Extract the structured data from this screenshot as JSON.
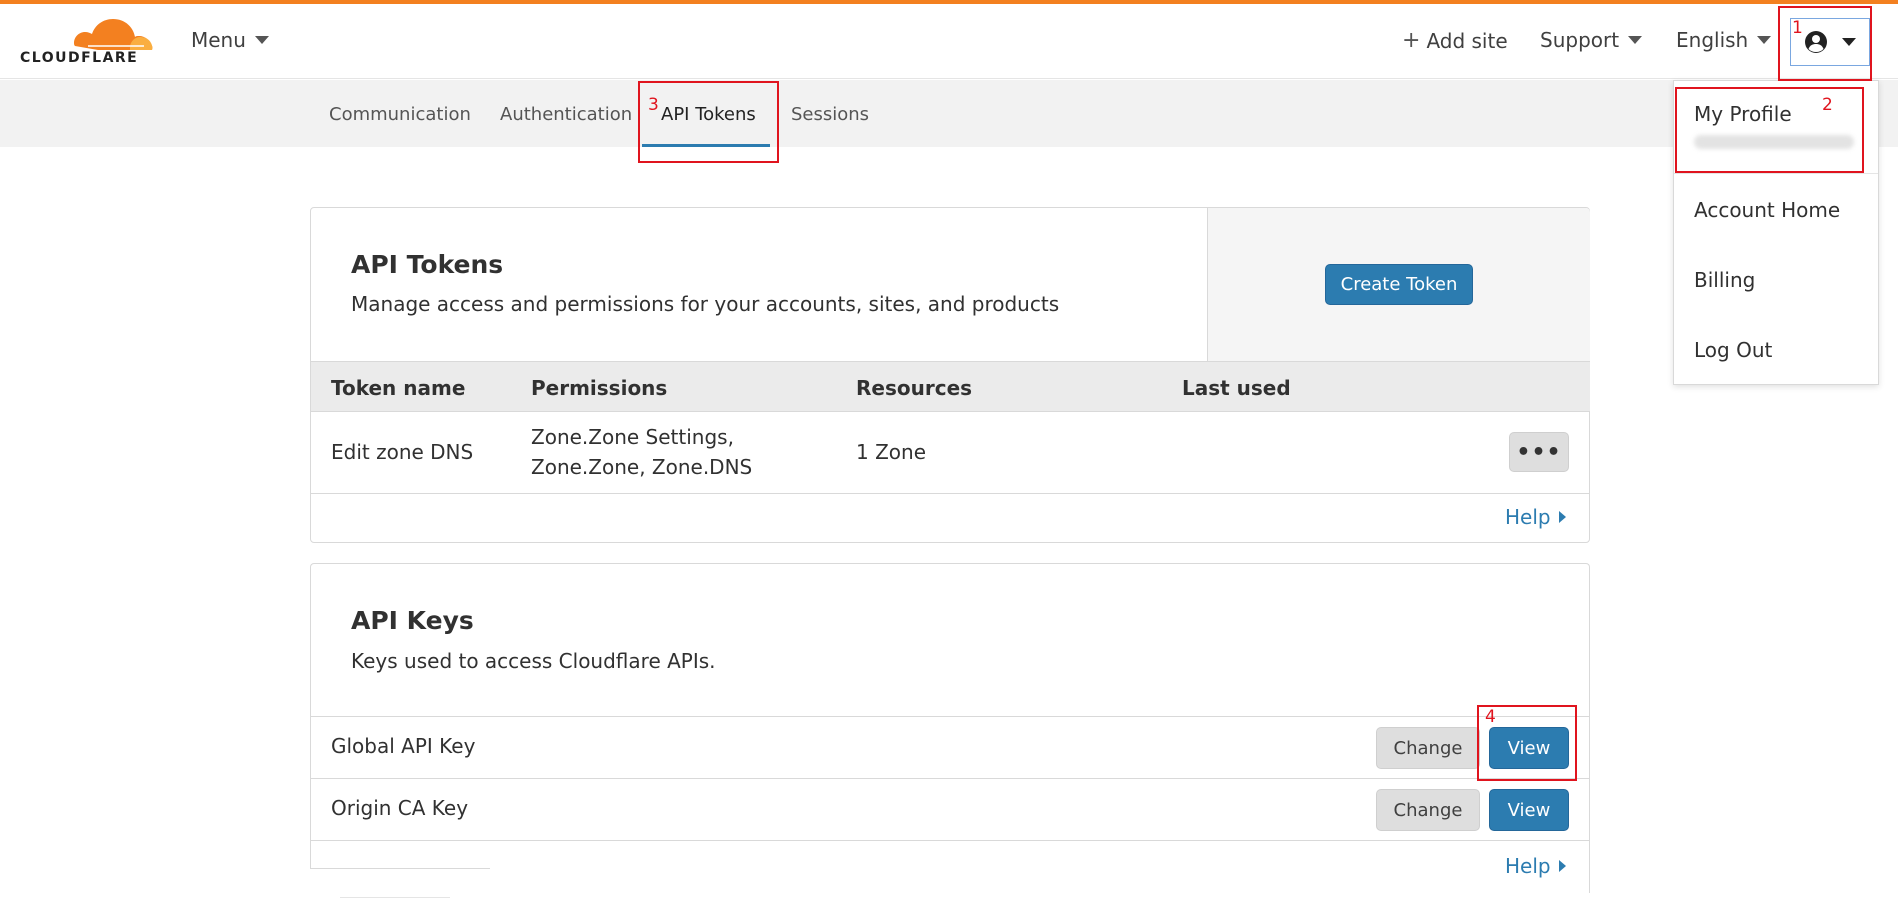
{
  "brand": {
    "logo_text": "CLOUDFLARE",
    "accent_color": "#f38020",
    "link_color": "#2c7cb0"
  },
  "header": {
    "menu_label": "Menu",
    "add_site_label": "Add site",
    "support_label": "Support",
    "language_label": "English",
    "account_icon": "user-circle-icon"
  },
  "subnav": {
    "tabs": [
      {
        "label": "Communication"
      },
      {
        "label": "Authentication"
      },
      {
        "label": "API Tokens",
        "active": true
      },
      {
        "label": "Sessions"
      }
    ]
  },
  "api_tokens": {
    "title": "API Tokens",
    "description": "Manage access and permissions for your accounts, sites, and products",
    "create_button": "Create Token",
    "columns": [
      "Token name",
      "Permissions",
      "Resources",
      "Last used"
    ],
    "rows": [
      {
        "name": "Edit zone DNS",
        "permissions_line1": "Zone.Zone Settings,",
        "permissions_line2": "Zone.Zone, Zone.DNS",
        "resources": "1 Zone",
        "last_used": "",
        "menu_label": "•••"
      }
    ],
    "help_label": "Help"
  },
  "api_keys": {
    "title": "API Keys",
    "description": "Keys used to access Cloudflare APIs.",
    "keys": [
      {
        "name": "Global API Key",
        "change_label": "Change",
        "view_label": "View"
      },
      {
        "name": "Origin CA Key",
        "change_label": "Change",
        "view_label": "View"
      }
    ],
    "help_label": "Help"
  },
  "account_menu": {
    "items": [
      {
        "label": "My Profile"
      },
      {
        "label": "Account Home"
      },
      {
        "label": "Billing"
      },
      {
        "label": "Log Out"
      }
    ]
  },
  "annotations": {
    "color": "#e0141e",
    "steps": [
      "1",
      "2",
      "3",
      "4"
    ]
  }
}
